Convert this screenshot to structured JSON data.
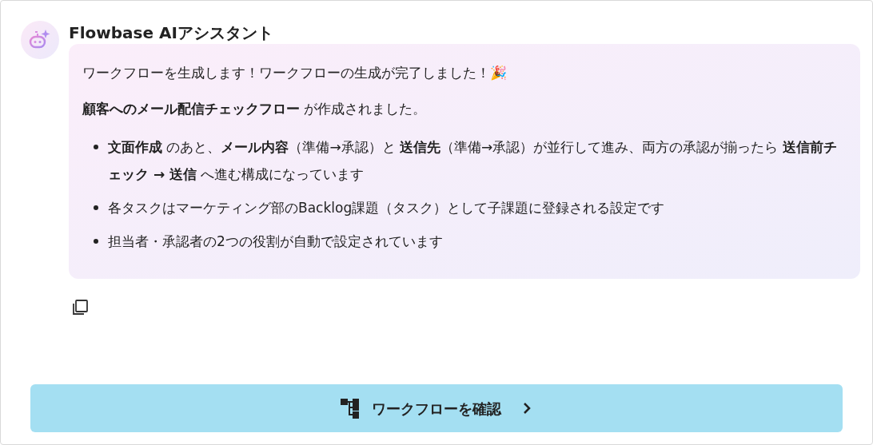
{
  "assistant": {
    "name": "Flowbase AIアシスタント"
  },
  "message": {
    "intro": "ワークフローを生成します！ワークフローの生成が完了しました！🎉",
    "summary": "**顧客へのメール配信チェックフロー** が作成されました。",
    "bullets": [
      "**文面作成** のあと、**メール内容**（準備→承認）と **送信先**（準備→承認）が並行して進み、両方の承認が揃ったら **送信前チェック → 送信** へ進む構成になっています",
      "各タスクはマーケティング部のBacklog課題（タスク）として子課題に登録される設定です",
      "担当者・承認者の2つの役割が自動で設定されています"
    ]
  },
  "action_button": {
    "label": "ワークフローを確認"
  }
}
